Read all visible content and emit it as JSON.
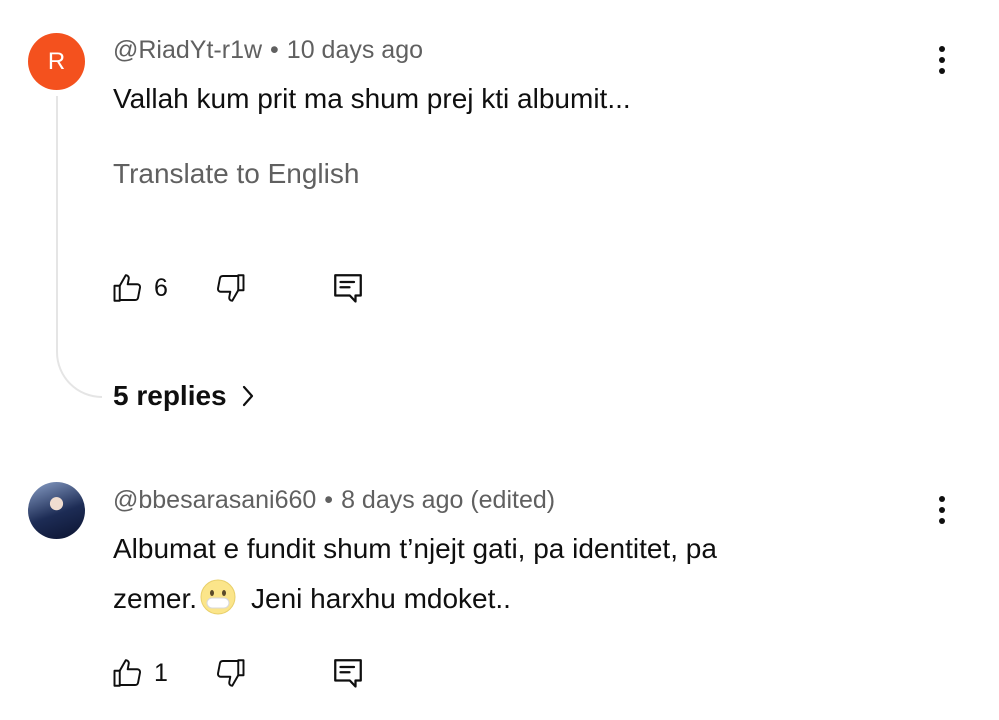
{
  "comments": [
    {
      "avatar_letter": "R",
      "avatar_color": "#f4511e",
      "author": "@RiadYt-r1w",
      "separator": "•",
      "time": "10 days ago",
      "text": "Vallah kum prit ma shum prej kti albumit...",
      "translate_label": "Translate to English",
      "likes": "6",
      "replies_label": "5 replies"
    },
    {
      "author": "@bbesarasani660",
      "separator": "•",
      "time": "8 days ago (edited)",
      "text_line1": "Albumat e fundit shum t’njejt gati, pa identitet, pa",
      "text_line2_before": "zemer.",
      "emoji": "face-with-mouth-covered",
      "text_line2_after": "Jeni harxhu mdoket..",
      "likes": "1"
    }
  ],
  "icons": {
    "like": "thumbs-up-icon",
    "dislike": "thumbs-down-icon",
    "reply": "reply-comment-icon",
    "more": "more-vertical-icon",
    "chevron": "chevron-right-icon"
  },
  "colors": {
    "text_primary": "#0f0f0f",
    "text_secondary": "#606060",
    "thread_line": "#e5e5e5"
  }
}
